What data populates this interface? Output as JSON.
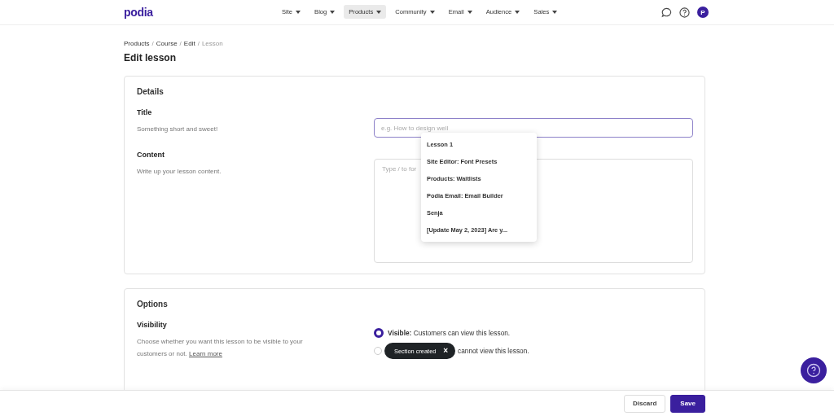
{
  "nav": {
    "logo": "podia",
    "menu": [
      {
        "label": "Site",
        "selected": false
      },
      {
        "label": "Blog",
        "selected": false
      },
      {
        "label": "Products",
        "selected": true
      },
      {
        "label": "Community",
        "selected": false
      },
      {
        "label": "Email",
        "selected": false
      },
      {
        "label": "Audience",
        "selected": false
      },
      {
        "label": "Sales",
        "selected": false
      }
    ],
    "avatar": "P"
  },
  "breadcrumb": {
    "separator": "/",
    "items": [
      "Products",
      "Course",
      "Edit",
      "Lesson"
    ]
  },
  "page_title": "Edit lesson",
  "details": {
    "heading": "Details",
    "fields": [
      {
        "kind": "input",
        "label": "Title",
        "description": "Something short and sweet!",
        "placeholder": "e.g. How to design well"
      },
      {
        "kind": "editor",
        "label": "Content",
        "description": "Write up your lesson content.",
        "placeholder": "Type / to for"
      }
    ]
  },
  "dropdown": {
    "items": [
      "Lesson 1",
      "Site Editor: Font Presets",
      "Products: Waitlists",
      "Podia Email: Email Builder",
      "Senja",
      "[Update May 2, 2023] Are y..."
    ]
  },
  "options": {
    "heading": "Options",
    "visibility": {
      "label": "Visibility",
      "description": "Choose whether you want this lesson to be visible to your customers or not.",
      "link": "Learn more",
      "choices": [
        {
          "label": "**Visible:** Customers can view this lesson.",
          "selected": true
        },
        {
          "label": "cannot view this lesson.",
          "selected": false
        }
      ]
    }
  },
  "toast": {
    "text": "Section created",
    "close": "×"
  },
  "footer": {
    "buttons": [
      {
        "label": "Discard",
        "kind": "secondary"
      },
      {
        "label": "Save",
        "kind": "primary"
      }
    ]
  }
}
